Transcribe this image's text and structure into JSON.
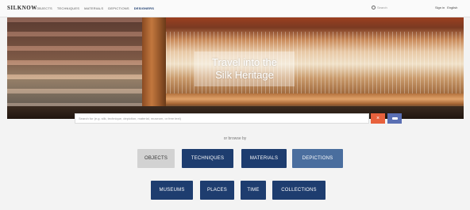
{
  "header": {
    "logo": "SILKNOW",
    "nav": [
      "OBJECTS",
      "TECHNIQUES",
      "MATERIALS",
      "DEPICTIONS",
      "DESIGNERS"
    ],
    "search_placeholder": "Search",
    "user": "Sign in",
    "language": "English"
  },
  "hero": {
    "title_line1": "Travel into the",
    "title_line2": "Silk Heritage"
  },
  "search": {
    "placeholder": "Search for (e.g. silk, technique, depiction, material, museum, or free text)",
    "clear_icon": "close-icon",
    "submit_icon": "search-icon"
  },
  "browse": {
    "label": "or browse by",
    "row1": [
      "OBJECTS",
      "TECHNIQUES",
      "MATERIALS",
      "DEPICTIONS"
    ],
    "row2": [
      "MUSEUMS",
      "PLACES",
      "TIME",
      "COLLECTIONS"
    ]
  },
  "colors": {
    "primary": "#1e3d6f",
    "selected": "#d2d2d2",
    "light_button": "#4a6e9e",
    "clear": "#e8613c",
    "submit": "#5a6fb3"
  }
}
